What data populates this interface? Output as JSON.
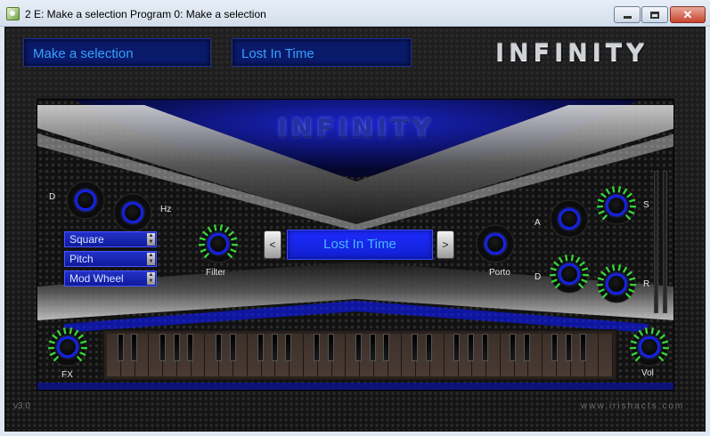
{
  "window": {
    "title": "2 E: Make a selection Program 0: Make a selection",
    "close_glyph": "✕"
  },
  "header": {
    "left_field": "Make a selection",
    "right_field": "Lost In Time",
    "logo": "INFINITY"
  },
  "panel": {
    "logo": "INFINITY",
    "preset_name": "Lost In Time",
    "prev_label": "<",
    "next_label": ">"
  },
  "knobs": {
    "d_left": "D",
    "hz": "Hz",
    "filter": "Filter",
    "porto": "Porto",
    "a": "A",
    "s": "S",
    "d_right": "D",
    "r": "R",
    "fx": "FX",
    "vol": "Vol"
  },
  "selects": [
    {
      "value": "Square"
    },
    {
      "value": "Pitch"
    },
    {
      "value": "Mod Wheel"
    }
  ],
  "footer": {
    "version": "v3.0",
    "website": "www.irishacts.com"
  },
  "colors": {
    "accent_blue": "#1522e0",
    "led_green": "#38d038",
    "display_text": "#45b8ff"
  }
}
